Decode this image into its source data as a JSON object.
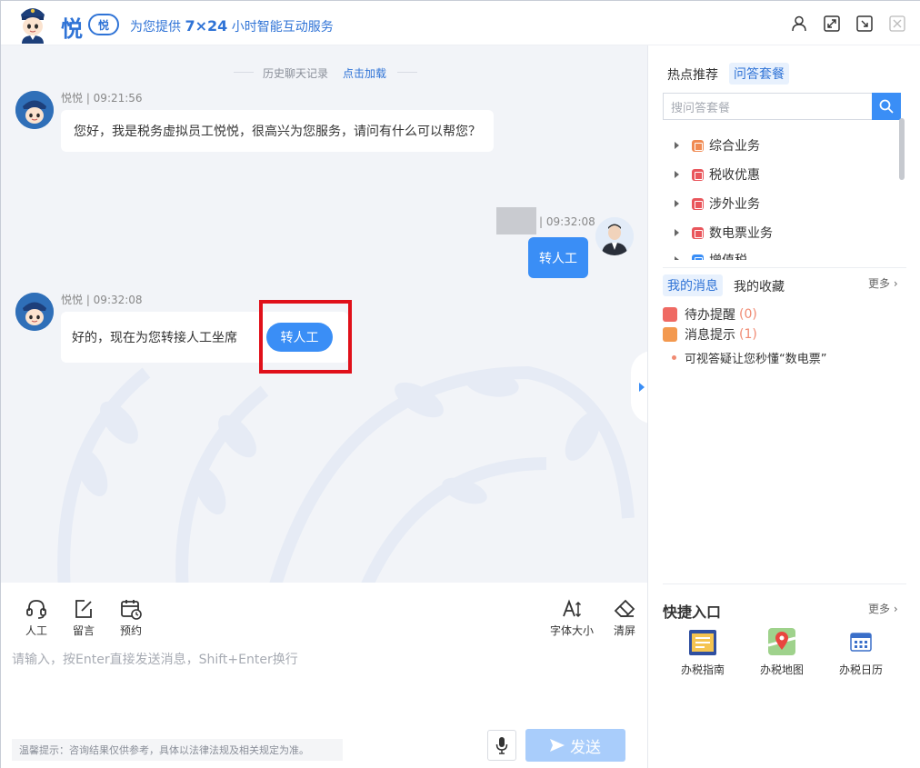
{
  "header": {
    "logo_text": "悦",
    "logo_badge": "悦",
    "tagline_prefix": "为您提供",
    "tagline_hours": "7×24",
    "tagline_suffix": "小时智能互动服务",
    "icons": [
      "user-icon",
      "expand-icon",
      "minimize-window-icon",
      "close-icon"
    ]
  },
  "chat": {
    "history_label": "历史聊天记录",
    "history_link": "点击加载",
    "messages": [
      {
        "sender": "悦悦",
        "time": "09:21:56",
        "meta": "悦悦 | 09:21:56",
        "text": "您好，我是税务虚拟员工悦悦，很高兴为您服务，请问有什么可以帮您？"
      },
      {
        "sender": "user",
        "meta": "| 09:32:08",
        "text": "转人工"
      },
      {
        "sender": "悦悦",
        "meta": "悦悦 | 09:32:08",
        "text": "好的，现在为您转接人工坐席",
        "button": "转人工"
      }
    ]
  },
  "toolbar": {
    "left_tools": [
      "人工",
      "留言",
      "预约"
    ],
    "right_tools": [
      "字体大小",
      "清屏"
    ]
  },
  "input": {
    "placeholder": "请输入，按Enter直接发送消息，Shift+Enter换行",
    "tip": "温馨提示：咨询结果仅供参考，具体以法律法规及相关规定为准。",
    "send_label": "发送"
  },
  "right_panel": {
    "tabs": [
      "热点推荐",
      "问答套餐"
    ],
    "active_tab": "问答套餐",
    "search_placeholder": "搜问答套餐",
    "tree": [
      {
        "label": "综合业务",
        "color": "#f08a52"
      },
      {
        "label": "税收优惠",
        "color": "#e9565c"
      },
      {
        "label": "涉外业务",
        "color": "#e9565c"
      },
      {
        "label": "数电票业务",
        "color": "#e9565c"
      },
      {
        "label": "增值税",
        "color": "#3a8ef6"
      }
    ],
    "msg_tabs": [
      "我的消息",
      "我的收藏"
    ],
    "more_label": "更多",
    "reminders": [
      {
        "label": "待办提醒",
        "count": "(0)",
        "color": "#ef6a63"
      },
      {
        "label": "消息提示",
        "count": "(1)",
        "color": "#f3994f"
      }
    ],
    "bullet": "可视答疑让您秒懂“数电票”",
    "quick_title": "快捷入口",
    "quick_more": "更多",
    "quick_items": [
      "办税指南",
      "办税地图",
      "办税日历"
    ]
  },
  "colors": {
    "brand": "#2f73d6",
    "accent": "#3a8ef6",
    "highlight": "#e0101a"
  }
}
